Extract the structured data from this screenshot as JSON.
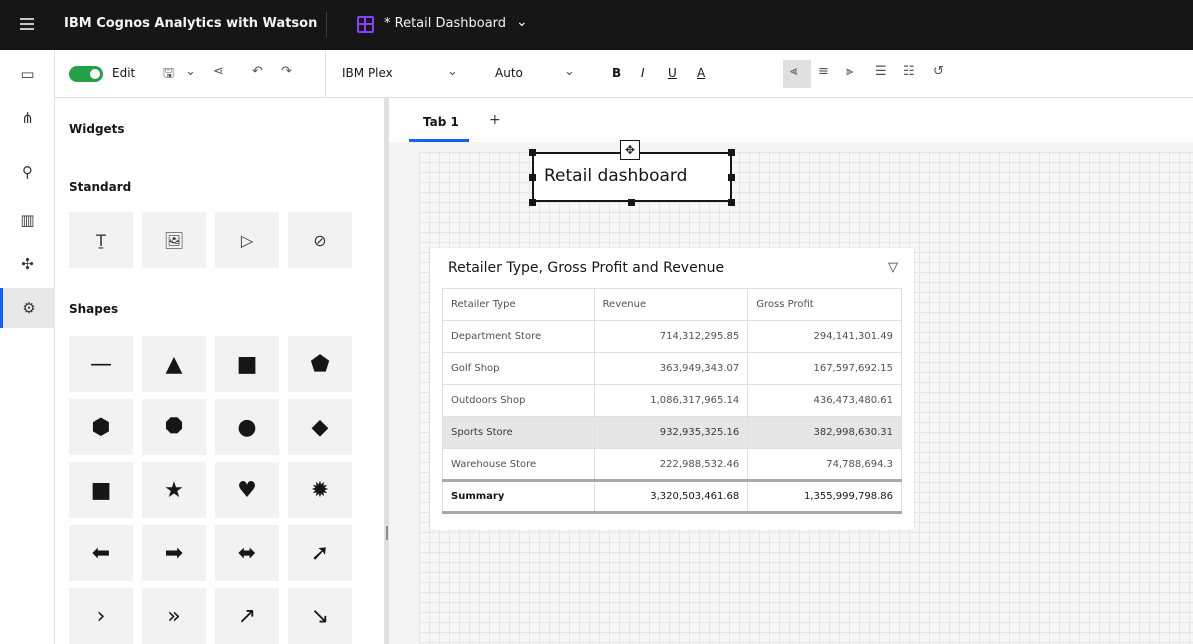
{
  "header": {
    "product": "IBM Cognos Analytics with Watson",
    "doc_title": "* Retail Dashboard"
  },
  "toolbar": {
    "edit_label": "Edit",
    "font_family": "IBM Plex",
    "font_size": "Auto"
  },
  "panel": {
    "title": "Widgets",
    "standard_heading": "Standard",
    "shapes_heading": "Shapes",
    "standard_icons": [
      "text-icon",
      "image-icon",
      "media-icon",
      "webpage-icon"
    ],
    "shapes": [
      {
        "name": "line-shape",
        "glyph": "—"
      },
      {
        "name": "triangle-shape",
        "glyph": "▲"
      },
      {
        "name": "square-shape",
        "glyph": "■"
      },
      {
        "name": "pentagon-shape",
        "glyph": "⬟"
      },
      {
        "name": "hexagon-shape",
        "glyph": "⬢"
      },
      {
        "name": "octagon-shape",
        "glyph": "⯃"
      },
      {
        "name": "circle-shape",
        "glyph": "●"
      },
      {
        "name": "diamond-shape",
        "glyph": "◆"
      },
      {
        "name": "rounded-square-shape",
        "glyph": "■"
      },
      {
        "name": "star-shape",
        "glyph": "★"
      },
      {
        "name": "heart-shape",
        "glyph": "♥"
      },
      {
        "name": "seal-shape",
        "glyph": "✹"
      },
      {
        "name": "arrow-left-shape",
        "glyph": "⬅"
      },
      {
        "name": "arrow-right-shape",
        "glyph": "➡"
      },
      {
        "name": "arrow-both-shape",
        "glyph": "⬌"
      },
      {
        "name": "arrow-curved-shape",
        "glyph": "➚"
      },
      {
        "name": "chevron-shape",
        "glyph": "›"
      },
      {
        "name": "double-chevron-shape",
        "glyph": "»"
      },
      {
        "name": "trend-up-shape",
        "glyph": "↗"
      },
      {
        "name": "trend-down-shape",
        "glyph": "↘"
      }
    ]
  },
  "tabs": [
    {
      "label": "Tab 1"
    }
  ],
  "tab_add": "+",
  "text_widget": {
    "text": "Retail dashboard"
  },
  "table_widget": {
    "title": "Retailer Type, Gross Profit and Revenue",
    "columns": [
      "Retailer Type",
      "Revenue",
      "Gross Profit"
    ],
    "rows": [
      [
        "Department Store",
        "714,312,295.85",
        "294,141,301.49"
      ],
      [
        "Golf Shop",
        "363,949,343.07",
        "167,597,692.15"
      ],
      [
        "Outdoors Shop",
        "1,086,317,965.14",
        "436,473,480.61"
      ],
      [
        "Sports Store",
        "932,935,325.16",
        "382,998,630.31"
      ],
      [
        "Warehouse Store",
        "222,988,532.46",
        "74,788,694.3"
      ]
    ],
    "summary": [
      "Summary",
      "3,320,503,461.68",
      "1,355,999,798.86"
    ],
    "highlighted_row": 3
  },
  "colors": {
    "accent": "#0f62fe",
    "toggle_on": "#24a148",
    "topbar": "#161616"
  }
}
